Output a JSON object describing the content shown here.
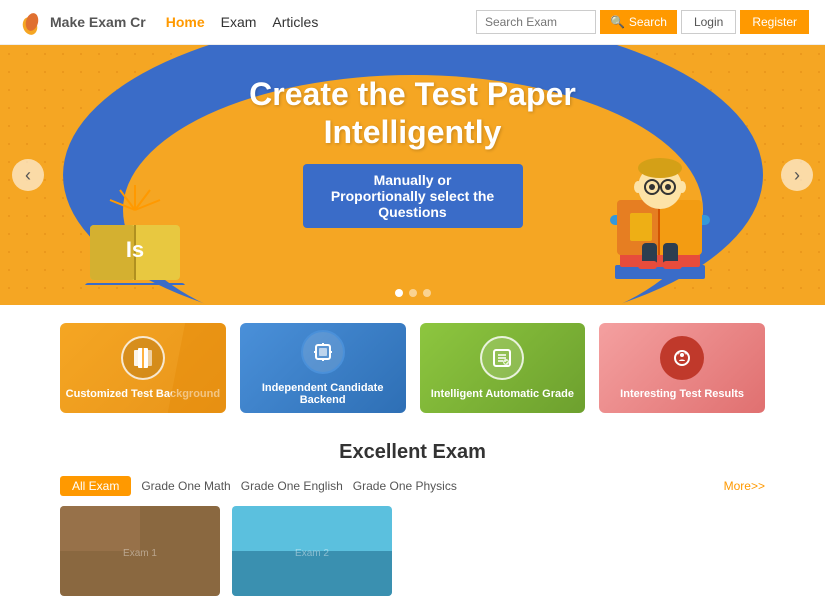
{
  "header": {
    "logo_text": "Make Exam Cr",
    "nav": {
      "home": "Home",
      "exam": "Exam",
      "articles": "Articles"
    },
    "search_placeholder": "Search Exam",
    "search_btn": "Search",
    "login_btn": "Login",
    "register_btn": "Register"
  },
  "hero": {
    "title_line1": "Create the Test Paper",
    "title_line2": "Intelligently",
    "subtitle": "Manually or Proportionally select the Questions",
    "prev_label": "‹",
    "next_label": "›",
    "dots": [
      true,
      false,
      false
    ]
  },
  "features": [
    {
      "id": "customized",
      "label": "Customized Test Background",
      "icon": "📖",
      "color_class": "fc-yellow"
    },
    {
      "id": "candidate",
      "label": "Independent Candidate Backend",
      "icon": "📦",
      "color_class": "fc-blue"
    },
    {
      "id": "grade",
      "label": "Intelligent Automatic Grade",
      "icon": "📋",
      "color_class": "fc-green"
    },
    {
      "id": "results",
      "label": "Interesting Test Results",
      "icon": "🧠",
      "color_class": "fc-pink"
    }
  ],
  "excellent": {
    "title": "Excellent Exam",
    "filters": [
      "All Exam",
      "Grade One Math",
      "Grade One English",
      "Grade One Physics"
    ],
    "more_link": "More>>",
    "exams": [
      {
        "id": 1,
        "type": "brown"
      },
      {
        "id": 2,
        "type": "blue"
      }
    ]
  }
}
